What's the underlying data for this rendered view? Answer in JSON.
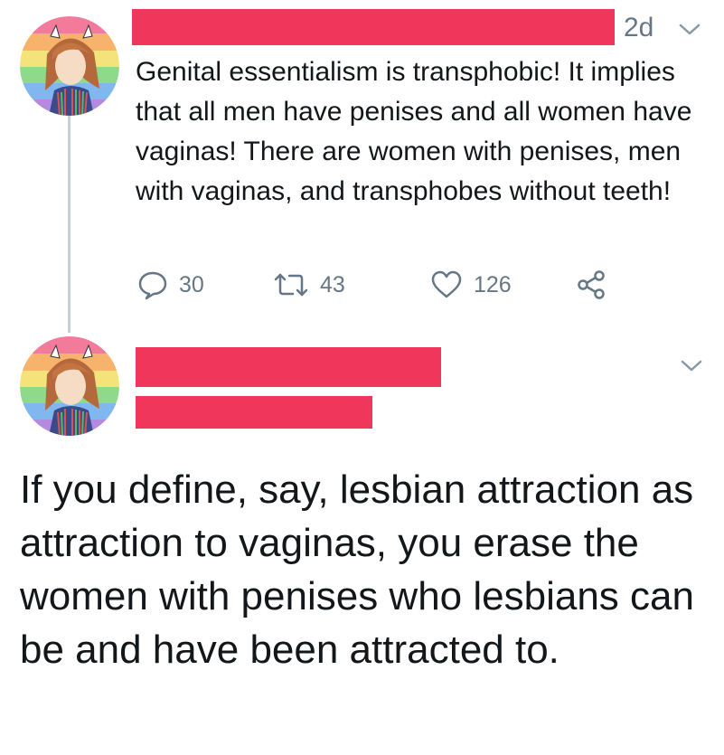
{
  "tweet1": {
    "time": "2d",
    "text": "Genital essentialism is transphobic! It implies that all men have penises and all women have vaginas! There are women with penises, men with vaginas, and transphobes without teeth!",
    "actions": {
      "reply_count": "30",
      "retweet_count": "43",
      "like_count": "126"
    },
    "icons": [
      "reply-icon",
      "retweet-icon",
      "heart-icon",
      "share-icon",
      "chevron-down-icon"
    ]
  },
  "tweet2": {
    "text": "If you define, say, lesbian attraction as attraction to vaginas, you erase the women with penises who lesbians can be and have been attracted to.",
    "icons": [
      "chevron-down-icon"
    ]
  },
  "colors": {
    "redaction": "#f0365a",
    "secondary_text": "#657786",
    "primary_text": "#14171a",
    "thread_line": "#c4cfd6"
  }
}
